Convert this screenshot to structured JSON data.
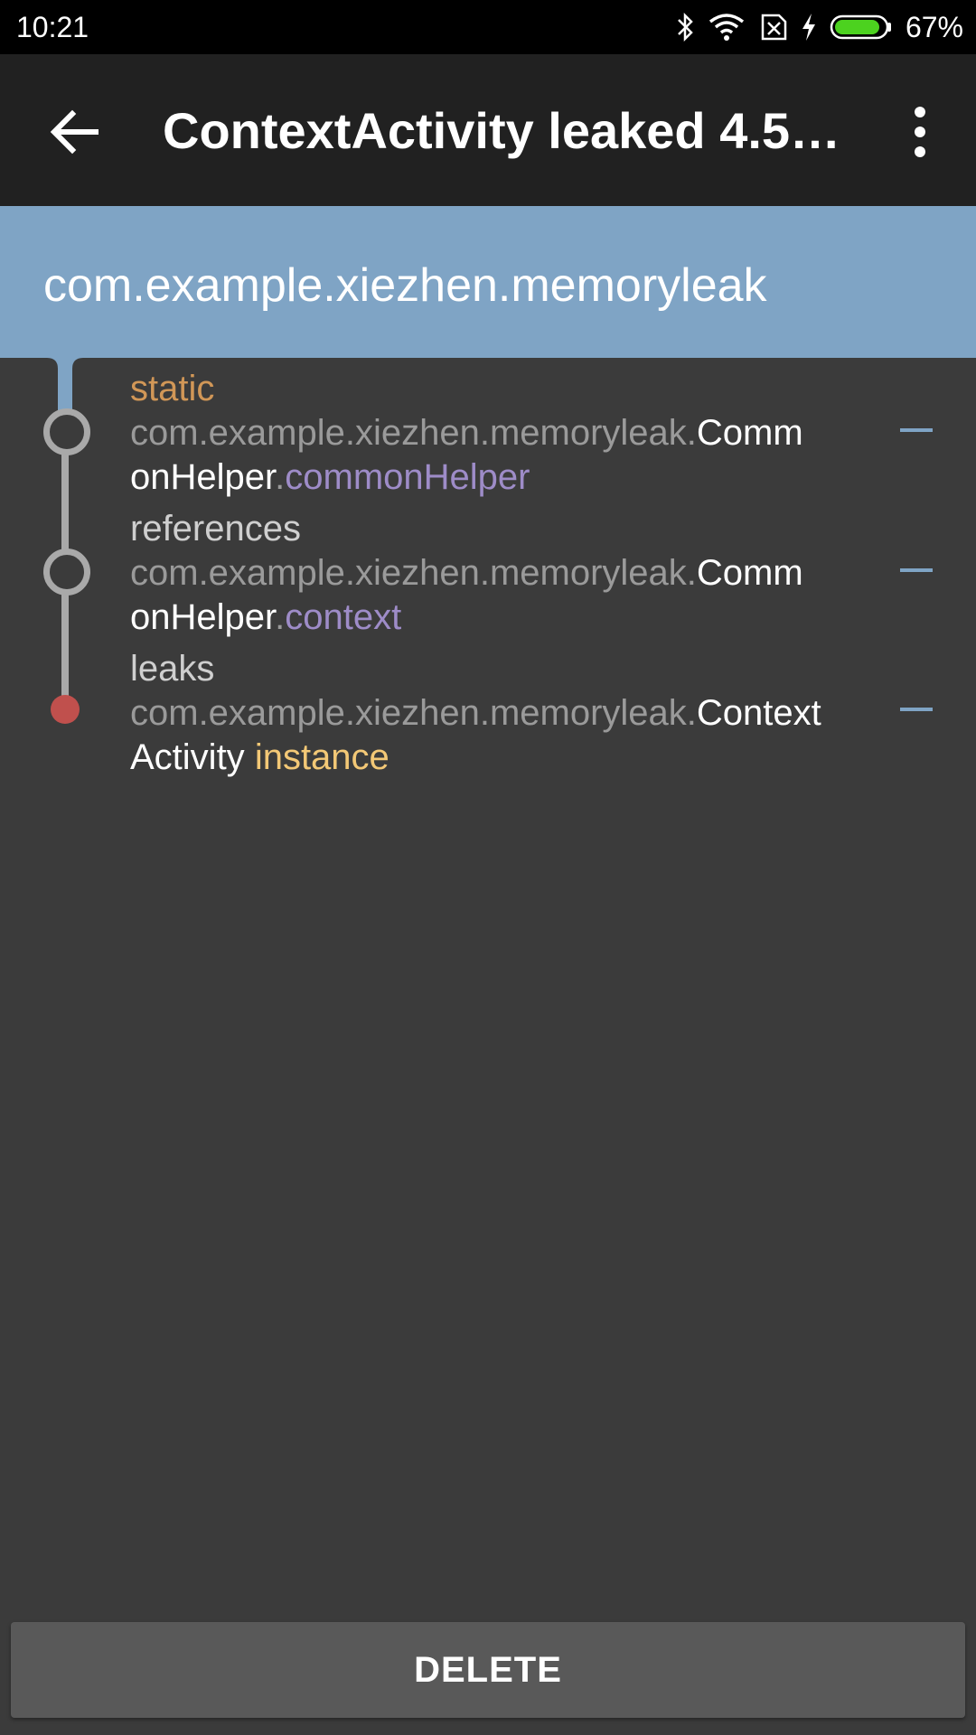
{
  "status_bar": {
    "time": "10:21",
    "battery_percent": "67%",
    "battery_level": 0.67,
    "icons": [
      "bluetooth-icon",
      "wifi-icon",
      "no-sim-icon",
      "charging-icon",
      "battery-icon"
    ]
  },
  "app_bar": {
    "title": "ContextActivity leaked 4.5…",
    "back_icon": "arrow-back-icon",
    "menu_icon": "more-vert-icon"
  },
  "header": {
    "package": "com.example.xiezhen.memoryleak"
  },
  "trace": [
    {
      "label": "static",
      "package_prefix": "com.example.xiezhen.memoryleak.",
      "class_line1": "Comm",
      "class_line2": "onHelper",
      "separator": ".",
      "field": "commonHelper"
    },
    {
      "label": "references",
      "package_prefix": "com.example.xiezhen.memoryleak.",
      "class_line1": "Comm",
      "class_line2": "onHelper",
      "separator": ".",
      "field": "context"
    },
    {
      "label": "leaks",
      "package_prefix": "com.example.xiezhen.memoryleak.",
      "class_line1": "Context",
      "class_line2": "Activity",
      "separator": " ",
      "field": "instance"
    }
  ],
  "colors": {
    "header_bg": "#7fa4c5",
    "leak_dot": "#c0504d",
    "static_label": "#d19757",
    "field": "#9e8cc8",
    "instance": "#f3c876"
  },
  "footer": {
    "delete_label": "DELETE"
  }
}
